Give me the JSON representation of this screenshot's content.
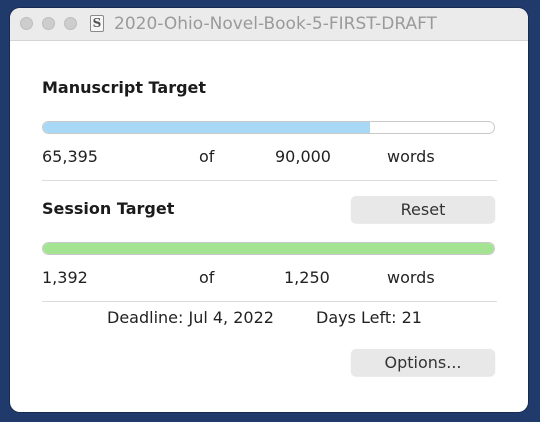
{
  "window": {
    "title": "2020-Ohio-Novel-Book-5-FIRST-DRAFT",
    "doc_icon_letter": "S"
  },
  "manuscript": {
    "heading": "Manuscript Target",
    "current": "65,395",
    "of_label": "of",
    "target": "90,000",
    "unit": "words",
    "progress_fraction": 0.726,
    "bar_color": "#a8d8f5"
  },
  "session": {
    "heading": "Session Target",
    "reset_label": "Reset",
    "current": "1,392",
    "of_label": "of",
    "target": "1,250",
    "unit": "words",
    "progress_fraction": 1.0,
    "bar_color": "#a4e391"
  },
  "deadline": {
    "deadline_text": "Deadline: Jul 4, 2022",
    "days_left_text": "Days Left: 21"
  },
  "footer": {
    "options_label": "Options..."
  }
}
